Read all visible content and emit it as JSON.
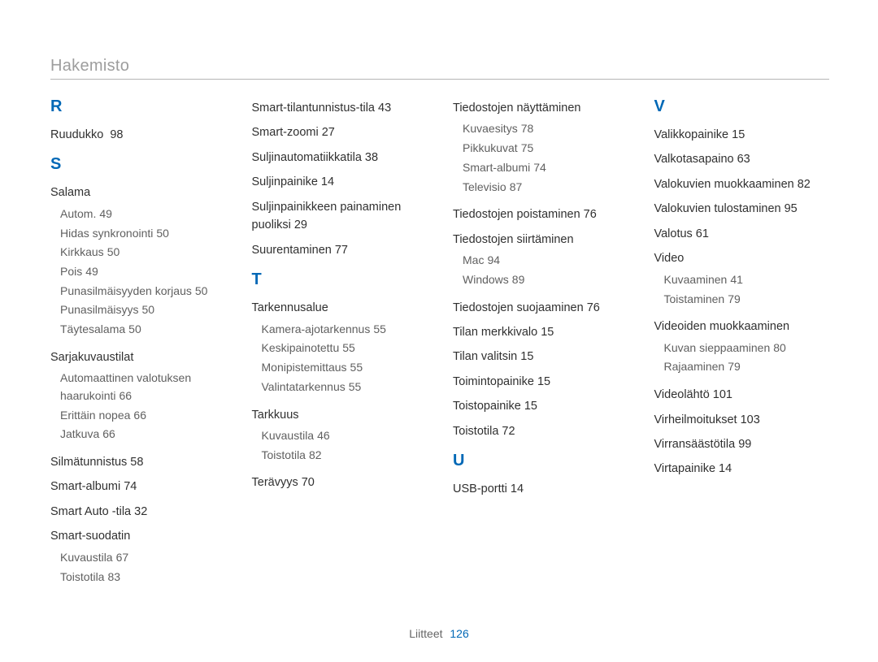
{
  "page_title": "Hakemisto",
  "footer_label": "Liitteet",
  "footer_page": "126",
  "letters": {
    "R": "R",
    "S": "S",
    "T": "T",
    "U": "U",
    "V": "V"
  },
  "col1": {
    "ruudukko": {
      "term": "Ruudukko",
      "page": "98"
    },
    "salama": {
      "term": "Salama",
      "subs": [
        {
          "term": "Autom.",
          "page": "49"
        },
        {
          "term": "Hidas synkronointi",
          "page": "50"
        },
        {
          "term": "Kirkkaus",
          "page": "50"
        },
        {
          "term": "Pois",
          "page": "49"
        },
        {
          "term": "Punasilmäisyyden korjaus",
          "page": "50"
        },
        {
          "term": "Punasilmäisyys",
          "page": "50"
        },
        {
          "term": "Täytesalama",
          "page": "50"
        }
      ]
    },
    "sarjakuvaustilat": {
      "term": "Sarjakuvaustilat",
      "subs": [
        {
          "term": "Automaattinen valotuksen haarukointi",
          "page": "66"
        },
        {
          "term": "Erittäin nopea",
          "page": "66"
        },
        {
          "term": "Jatkuva",
          "page": "66"
        }
      ]
    },
    "silmatunnistus": {
      "term": "Silmätunnistus",
      "page": "58"
    },
    "smart_albumi": {
      "term": "Smart-albumi",
      "page": "74"
    },
    "smart_auto": {
      "term": "Smart Auto -tila",
      "page": "32"
    },
    "smart_suodatin": {
      "term": "Smart-suodatin",
      "subs": [
        {
          "term": "Kuvaustila",
          "page": "67"
        },
        {
          "term": "Toistotila",
          "page": "83"
        }
      ]
    }
  },
  "col2": {
    "smart_tila": {
      "term": "Smart-tilantunnistus-tila",
      "page": "43"
    },
    "smart_zoomi": {
      "term": "Smart-zoomi",
      "page": "27"
    },
    "suljinauto": {
      "term": "Suljinautomatiikkatila",
      "page": "38"
    },
    "suljinpainike": {
      "term": "Suljinpainike",
      "page": "14"
    },
    "suljin_puoliksi": {
      "term": "Suljinpainikkeen painaminen puoliksi",
      "page": "29"
    },
    "suurentaminen": {
      "term": "Suurentaminen",
      "page": "77"
    },
    "tarkennusalue": {
      "term": "Tarkennusalue",
      "subs": [
        {
          "term": "Kamera-ajotarkennus",
          "page": "55"
        },
        {
          "term": "Keskipainotettu",
          "page": "55"
        },
        {
          "term": "Monipistemittaus",
          "page": "55"
        },
        {
          "term": "Valintatarkennus",
          "page": "55"
        }
      ]
    },
    "tarkkuus": {
      "term": "Tarkkuus",
      "subs": [
        {
          "term": "Kuvaustila",
          "page": "46"
        },
        {
          "term": "Toistotila",
          "page": "82"
        }
      ]
    },
    "teravyys": {
      "term": "Terävyys",
      "page": "70"
    }
  },
  "col3": {
    "tiedostojen_nayt": {
      "term": "Tiedostojen näyttäminen",
      "subs": [
        {
          "term": "Kuvaesitys",
          "page": "78"
        },
        {
          "term": "Pikkukuvat",
          "page": "75"
        },
        {
          "term": "Smart-albumi",
          "page": "74"
        },
        {
          "term": "Televisio",
          "page": "87"
        }
      ]
    },
    "tiedostojen_poist": {
      "term": "Tiedostojen poistaminen",
      "page": "76"
    },
    "tiedostojen_siirt": {
      "term": "Tiedostojen siirtäminen",
      "subs": [
        {
          "term": "Mac",
          "page": "94"
        },
        {
          "term": "Windows",
          "page": "89"
        }
      ]
    },
    "tiedostojen_suoj": {
      "term": "Tiedostojen suojaaminen",
      "page": "76"
    },
    "tilan_merkkivalo": {
      "term": "Tilan merkkivalo",
      "page": "15"
    },
    "tilan_valitsin": {
      "term": "Tilan valitsin",
      "page": "15"
    },
    "toimintopainike": {
      "term": "Toimintopainike",
      "page": "15"
    },
    "toistopainike": {
      "term": "Toistopainike",
      "page": "15"
    },
    "toistotila": {
      "term": "Toistotila",
      "page": "72"
    },
    "usb_portti": {
      "term": "USB-portti",
      "page": "14"
    }
  },
  "col4": {
    "valikkopainike": {
      "term": "Valikkopainike",
      "page": "15"
    },
    "valkotasapaino": {
      "term": "Valkotasapaino",
      "page": "63"
    },
    "valokuvien_muok": {
      "term": "Valokuvien muokkaaminen",
      "page": "82"
    },
    "valokuvien_tulost": {
      "term": "Valokuvien tulostaminen",
      "page": "95"
    },
    "valotus": {
      "term": "Valotus",
      "page": "61"
    },
    "video": {
      "term": "Video",
      "subs": [
        {
          "term": "Kuvaaminen",
          "page": "41"
        },
        {
          "term": "Toistaminen",
          "page": "79"
        }
      ]
    },
    "videoiden_muok": {
      "term": "Videoiden muokkaaminen",
      "subs": [
        {
          "term": "Kuvan sieppaaminen",
          "page": "80"
        },
        {
          "term": "Rajaaminen",
          "page": "79"
        }
      ]
    },
    "videolahto": {
      "term": "Videolähtö",
      "page": "101"
    },
    "virheilmoitukset": {
      "term": "Virheilmoitukset",
      "page": "103"
    },
    "virransaastotila": {
      "term": "Virransäästötila",
      "page": "99"
    },
    "virtapainike": {
      "term": "Virtapainike",
      "page": "14"
    }
  }
}
